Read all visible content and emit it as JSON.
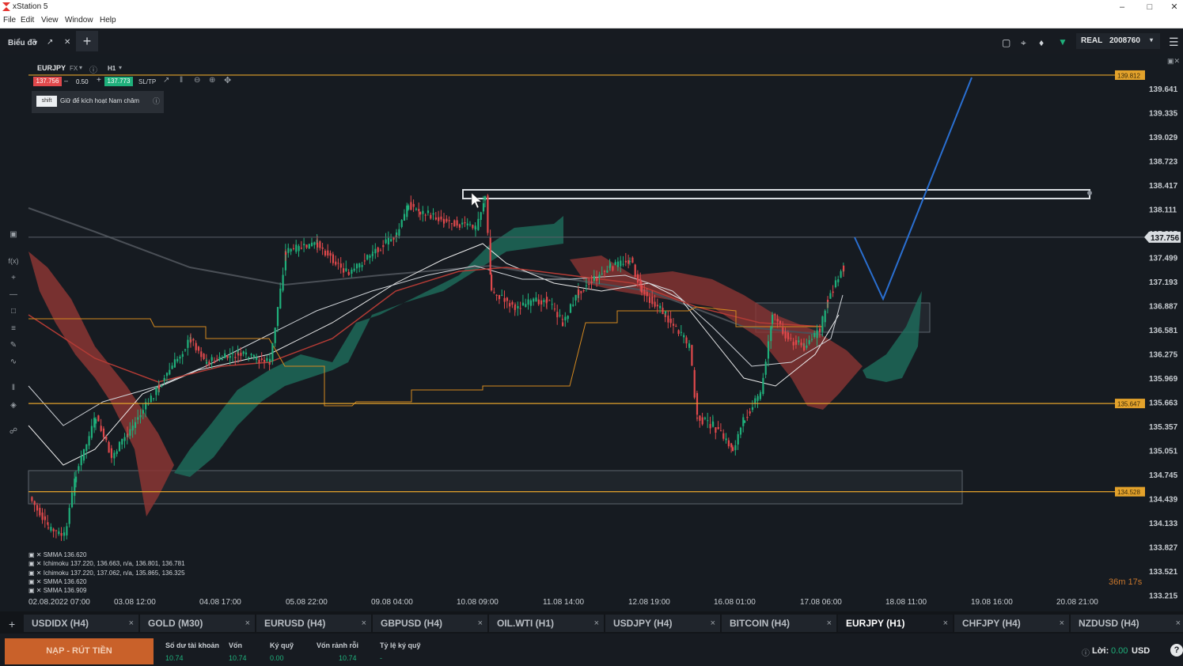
{
  "window": {
    "title": "xStation 5"
  },
  "menu": [
    "File",
    "Edit",
    "View",
    "Window",
    "Help"
  ],
  "toolbar": {
    "chart_menu": "Biểu đồ",
    "account_type": "REAL",
    "account_id": "2008760"
  },
  "chart_header": {
    "symbol": "EURJPY",
    "market": "FX",
    "timeframe": "H1",
    "sell_price": "137.756",
    "lot": "0.50",
    "buy_price": "137.773",
    "sltp": "SL/TP",
    "shift_key": "shift",
    "magnet_hint": "Giữ để kích hoạt Nam châm"
  },
  "chart_data": {
    "type": "candlestick",
    "price_ticks": [
      "139.641",
      "139.335",
      "139.029",
      "138.723",
      "138.417",
      "138.111",
      "137.805",
      "137.499",
      "137.193",
      "136.887",
      "136.581",
      "136.275",
      "135.969",
      "135.663",
      "135.357",
      "135.051",
      "134.745",
      "134.439",
      "134.133",
      "133.827",
      "133.521",
      "133.215"
    ],
    "date_ticks": [
      "02.08.2022 07:00",
      "03.08 12:00",
      "04.08 17:00",
      "05.08 22:00",
      "09.08 04:00",
      "10.08 09:00",
      "11.08 14:00",
      "12.08 19:00",
      "16.08 01:00",
      "17.08 06:00",
      "18.08 11:00",
      "19.08 16:00",
      "20.08 21:00"
    ],
    "horizontal_levels": [
      {
        "value": 139.812,
        "label": "139.812"
      },
      {
        "value": 135.647,
        "label": "135.647"
      },
      {
        "value": 134.528,
        "label": "134.528"
      }
    ],
    "current_price": {
      "value": 137.756,
      "label": "137.756"
    },
    "countdown": "36m 17s",
    "indicators": [
      "SMMA 136.620",
      "Ichimoku 137.220, 136.663, n/a, 136.801, 136.781",
      "Ichimoku 137.220, 137.062, n/a, 135.865, 136.325",
      "SMMA 136.620",
      "SMMA 136.909"
    ],
    "colors": {
      "bull": "#1fb07b",
      "bear": "#e0494c",
      "cloud_bull": "#1e6e5c",
      "cloud_bear": "#8a3533",
      "level": "#e3a22b",
      "projection": "#2a6fd1"
    }
  },
  "tabs": [
    {
      "label": "USDIDX (H4)",
      "active": false
    },
    {
      "label": "GOLD (M30)",
      "active": false
    },
    {
      "label": "EURUSD (H4)",
      "active": false
    },
    {
      "label": "GBPUSD (H4)",
      "active": false
    },
    {
      "label": "OIL.WTI (H1)",
      "active": false
    },
    {
      "label": "USDJPY (H4)",
      "active": false
    },
    {
      "label": "BITCOIN (H4)",
      "active": false
    },
    {
      "label": "EURJPY (H1)",
      "active": true
    },
    {
      "label": "CHFJPY (H4)",
      "active": false
    },
    {
      "label": "NZDUSD (H4)",
      "active": false
    }
  ],
  "bottom": {
    "deposit_button": "NẠP - RÚT TIỀN",
    "fields": [
      {
        "label": "Số dư tài khoản",
        "value": "10.74"
      },
      {
        "label": "Vốn",
        "value": "10.74"
      },
      {
        "label": "Ký quỹ",
        "value": "0.00"
      },
      {
        "label": "Vốn rảnh rỗi",
        "value": "10.74"
      },
      {
        "label": "Tỷ lệ ký quỹ",
        "value": "-"
      }
    ],
    "profit_label": "Lời:",
    "profit_value": "0.00",
    "currency": "USD"
  }
}
